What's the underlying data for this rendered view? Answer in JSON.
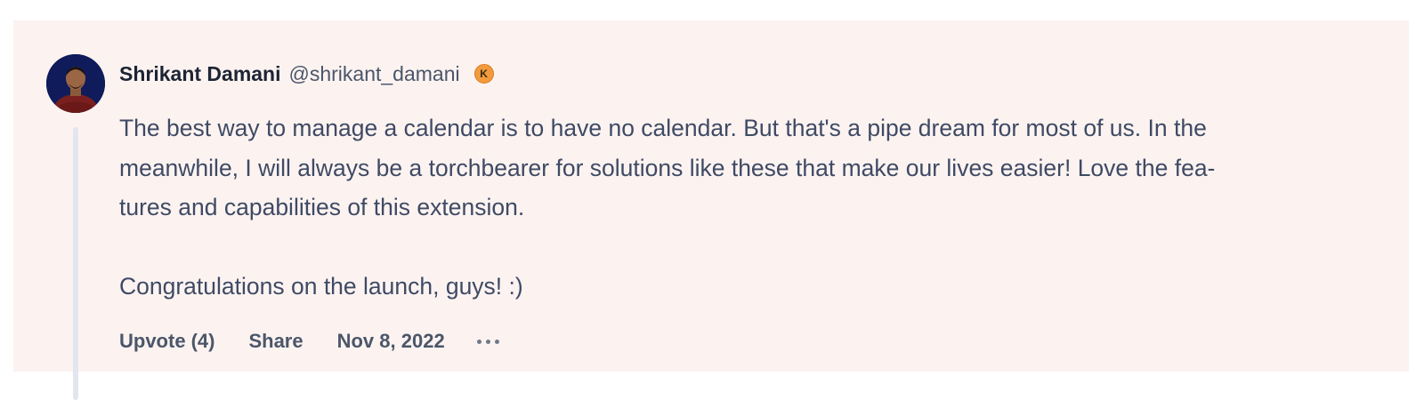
{
  "comment": {
    "author": {
      "name": "Shrikant Damani",
      "handle": "@shrikant_damani",
      "badge": "K",
      "avatar_icon": "user-avatar-photo"
    },
    "body": {
      "paragraph_1": "The best way to manage a calendar is to have no calendar. But that's a pipe dream for most of us. In the meanwhile, I will always be a torchbearer for solutions like these that make our lives easier! Love the fea-tures and capabilities of this extension.",
      "line_1": "The best way to manage a calendar is to have no calendar. But that's a pipe dream for most of us. In the",
      "line_2": "meanwhile, I will always be a torchbearer for solutions like these that make our lives easier! Love the fea-",
      "line_3": "tures and capabilities of this extension.",
      "paragraph_2": "Congratulations on the launch, guys! :)"
    },
    "actions": {
      "upvote_label": "Upvote",
      "upvote_count": "(4)",
      "share_label": "Share",
      "date": "Nov 8, 2022",
      "more_icon": "more-horizontal-icon"
    },
    "colors": {
      "card_background": "#fcf3f1",
      "thread_line": "#e2e6ef",
      "badge": "#f19a3e",
      "text": "#3f4a64",
      "author": "#1d2433"
    }
  }
}
